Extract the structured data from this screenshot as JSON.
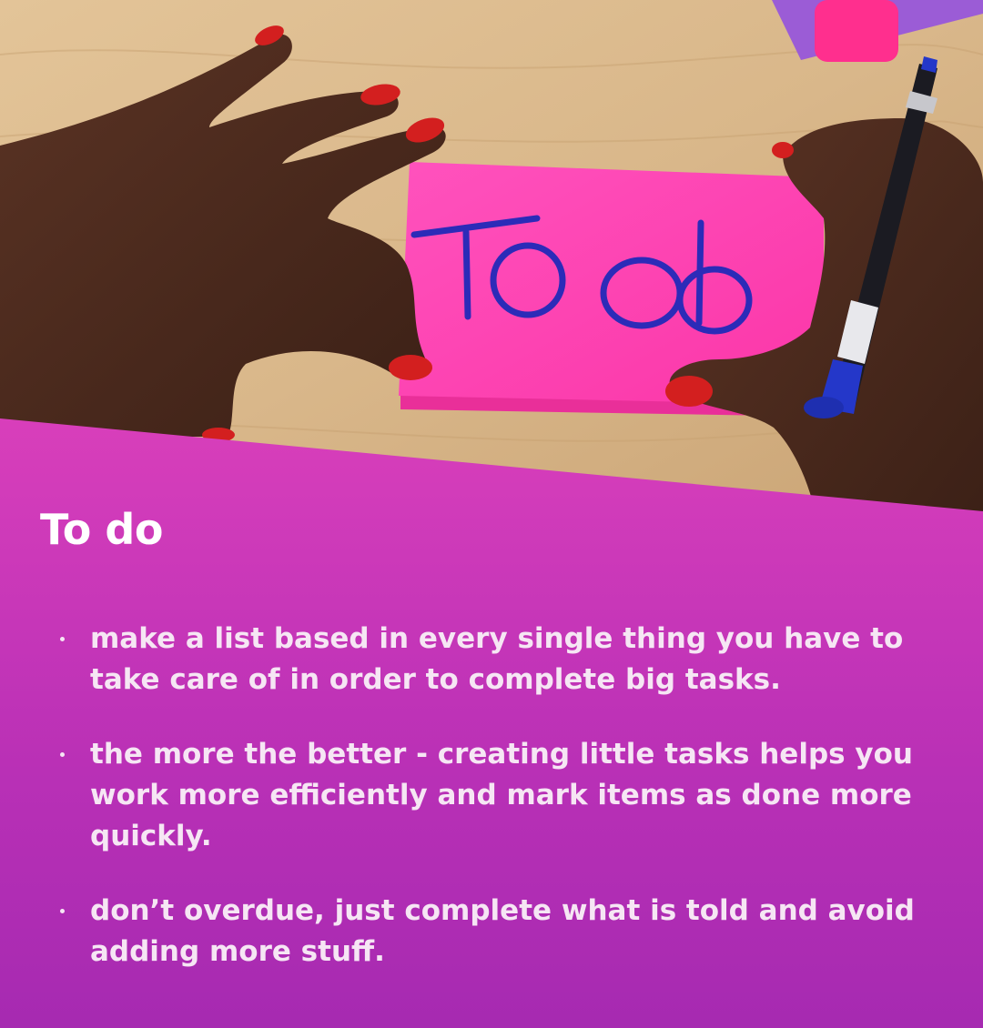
{
  "photo": {
    "note_text": "To do",
    "colors": {
      "desk": "#d9b78a",
      "sticky_note": "#ff3fb1",
      "ink": "#2c2bb8",
      "skin": "#4b2a1d",
      "nail_polish": "#d31f1f"
    }
  },
  "content": {
    "title": "To do",
    "bullets": [
      "make a list based in every single thing you have to take care of in order to complete big tasks.",
      "the more the better - creating little tasks helps you work more efficiently and mark items as done more quickly.",
      "don’t overdue, just complete what is told and avoid adding more stuff."
    ]
  },
  "colors": {
    "panel_top": "#f04cb9",
    "panel_bottom": "#a62ab1",
    "text": "#ffffff"
  }
}
